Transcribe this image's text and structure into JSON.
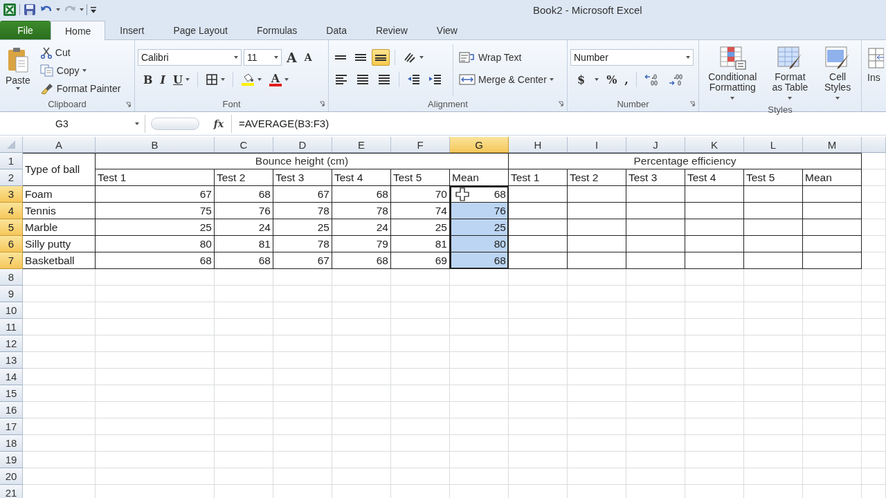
{
  "window": {
    "title": "Book2  -  Microsoft Excel"
  },
  "tabs": [
    {
      "label": "File",
      "kind": "file",
      "selected": false
    },
    {
      "label": "Home",
      "kind": "tab",
      "selected": true
    },
    {
      "label": "Insert",
      "kind": "tab",
      "selected": false
    },
    {
      "label": "Page Layout",
      "kind": "tab",
      "selected": false
    },
    {
      "label": "Formulas",
      "kind": "tab",
      "selected": false
    },
    {
      "label": "Data",
      "kind": "tab",
      "selected": false
    },
    {
      "label": "Review",
      "kind": "tab",
      "selected": false
    },
    {
      "label": "View",
      "kind": "tab",
      "selected": false
    }
  ],
  "ribbon": {
    "clipboard": {
      "label": "Clipboard",
      "paste": "Paste",
      "cut": "Cut",
      "copy": "Copy",
      "format_painter": "Format Painter"
    },
    "font": {
      "label": "Font",
      "font_name": "Calibri",
      "font_size": "11",
      "grow_font": "A",
      "shrink_font": "A",
      "bold": "B",
      "italic": "I",
      "underline": "U",
      "font_color": "A"
    },
    "alignment": {
      "label": "Alignment",
      "vertical_align": [
        {
          "selected": false
        },
        {
          "selected": false
        },
        {
          "selected": true
        }
      ],
      "wrap_text": "Wrap Text",
      "merge_center": "Merge & Center"
    },
    "number": {
      "label": "Number",
      "format": "Number",
      "currency": "$",
      "percent": "%",
      "comma": ","
    },
    "styles": {
      "label": "Styles",
      "buttons": [
        {
          "lines": [
            "Conditional",
            "Formatting"
          ],
          "kind": "conditional"
        },
        {
          "lines": [
            "Format",
            "as Table"
          ],
          "kind": "table"
        },
        {
          "lines": [
            "Cell",
            "Styles"
          ],
          "kind": "cell"
        }
      ]
    },
    "cells": {
      "insert": "Ins"
    }
  },
  "formula_bar": {
    "name_box": "G3",
    "function_label": "fx",
    "formula": "=AVERAGE(B3:F3)"
  },
  "sheet": {
    "columns": [
      {
        "label": "A",
        "selected": false
      },
      {
        "label": "B",
        "selected": false
      },
      {
        "label": "C",
        "selected": false
      },
      {
        "label": "D",
        "selected": false
      },
      {
        "label": "E",
        "selected": false
      },
      {
        "label": "F",
        "selected": false
      },
      {
        "label": "G",
        "selected": true
      },
      {
        "label": "H",
        "selected": false
      },
      {
        "label": "I",
        "selected": false
      },
      {
        "label": "J",
        "selected": false
      },
      {
        "label": "K",
        "selected": false
      },
      {
        "label": "L",
        "selected": false
      },
      {
        "label": "M",
        "selected": false
      }
    ],
    "rows": [
      {
        "label": "1",
        "selected": false,
        "cells": [
          {
            "text": "Type of ball",
            "kind": "heading",
            "selected": false
          },
          {
            "text": "Bounce height (cm)",
            "kind": "title",
            "selected": false
          },
          {
            "text": "Percentage efficiency",
            "kind": "title",
            "selected": false
          }
        ]
      },
      {
        "label": "2",
        "selected": false,
        "cells": [
          {
            "text": "Test 1",
            "kind": "text",
            "selected": false
          },
          {
            "text": "Test 2",
            "kind": "text",
            "selected": false
          },
          {
            "text": "Test 3",
            "kind": "text",
            "selected": false
          },
          {
            "text": "Test 4",
            "kind": "text",
            "selected": false
          },
          {
            "text": "Test 5",
            "kind": "text",
            "selected": false
          },
          {
            "text": "Mean",
            "kind": "text",
            "selected": false
          },
          {
            "text": "Test 1",
            "kind": "text",
            "selected": false
          },
          {
            "text": "Test 2",
            "kind": "text",
            "selected": false
          },
          {
            "text": "Test 3",
            "kind": "text",
            "selected": false
          },
          {
            "text": "Test 4",
            "kind": "text",
            "selected": false
          },
          {
            "text": "Test 5",
            "kind": "text",
            "selected": false
          },
          {
            "text": "Mean",
            "kind": "text",
            "selected": false
          }
        ]
      },
      {
        "label": "3",
        "selected": true,
        "cells": [
          {
            "text": "Foam",
            "kind": "text",
            "selected": false
          },
          {
            "text": "67",
            "kind": "number",
            "selected": false
          },
          {
            "text": "68",
            "kind": "number",
            "selected": false
          },
          {
            "text": "67",
            "kind": "number",
            "selected": false
          },
          {
            "text": "68",
            "kind": "number",
            "selected": false
          },
          {
            "text": "70",
            "kind": "number",
            "selected": false
          },
          {
            "text": "68",
            "kind": "number",
            "selected": true,
            "active": true
          }
        ]
      },
      {
        "label": "4",
        "selected": true,
        "cells": [
          {
            "text": "Tennis",
            "kind": "text",
            "selected": false
          },
          {
            "text": "75",
            "kind": "number",
            "selected": false
          },
          {
            "text": "76",
            "kind": "number",
            "selected": false
          },
          {
            "text": "78",
            "kind": "number",
            "selected": false
          },
          {
            "text": "78",
            "kind": "number",
            "selected": false
          },
          {
            "text": "74",
            "kind": "number",
            "selected": false
          },
          {
            "text": "76",
            "kind": "number",
            "selected": true
          }
        ]
      },
      {
        "label": "5",
        "selected": true,
        "cells": [
          {
            "text": "Marble",
            "kind": "text",
            "selected": false
          },
          {
            "text": "25",
            "kind": "number",
            "selected": false
          },
          {
            "text": "24",
            "kind": "number",
            "selected": false
          },
          {
            "text": "25",
            "kind": "number",
            "selected": false
          },
          {
            "text": "24",
            "kind": "number",
            "selected": false
          },
          {
            "text": "25",
            "kind": "number",
            "selected": false
          },
          {
            "text": "25",
            "kind": "number",
            "selected": true
          }
        ]
      },
      {
        "label": "6",
        "selected": true,
        "cells": [
          {
            "text": "Silly putty",
            "kind": "text",
            "selected": false
          },
          {
            "text": "80",
            "kind": "number",
            "selected": false
          },
          {
            "text": "81",
            "kind": "number",
            "selected": false
          },
          {
            "text": "78",
            "kind": "number",
            "selected": false
          },
          {
            "text": "79",
            "kind": "number",
            "selected": false
          },
          {
            "text": "81",
            "kind": "number",
            "selected": false
          },
          {
            "text": "80",
            "kind": "number",
            "selected": true
          }
        ]
      },
      {
        "label": "7",
        "selected": true,
        "cells": [
          {
            "text": "Basketball",
            "kind": "text",
            "selected": false
          },
          {
            "text": "68",
            "kind": "number",
            "selected": false
          },
          {
            "text": "68",
            "kind": "number",
            "selected": false
          },
          {
            "text": "67",
            "kind": "number",
            "selected": false
          },
          {
            "text": "68",
            "kind": "number",
            "selected": false
          },
          {
            "text": "69",
            "kind": "number",
            "selected": false
          },
          {
            "text": "68",
            "kind": "number",
            "selected": true
          }
        ]
      },
      {
        "label": "8",
        "selected": false
      },
      {
        "label": "9",
        "selected": false
      },
      {
        "label": "10",
        "selected": false
      },
      {
        "label": "11",
        "selected": false
      },
      {
        "label": "12",
        "selected": false
      },
      {
        "label": "13",
        "selected": false
      },
      {
        "label": "14",
        "selected": false
      },
      {
        "label": "15",
        "selected": false
      },
      {
        "label": "16",
        "selected": false
      },
      {
        "label": "17",
        "selected": false
      },
      {
        "label": "18",
        "selected": false
      },
      {
        "label": "19",
        "selected": false
      },
      {
        "label": "20",
        "selected": false
      },
      {
        "label": "21",
        "selected": false
      }
    ]
  }
}
